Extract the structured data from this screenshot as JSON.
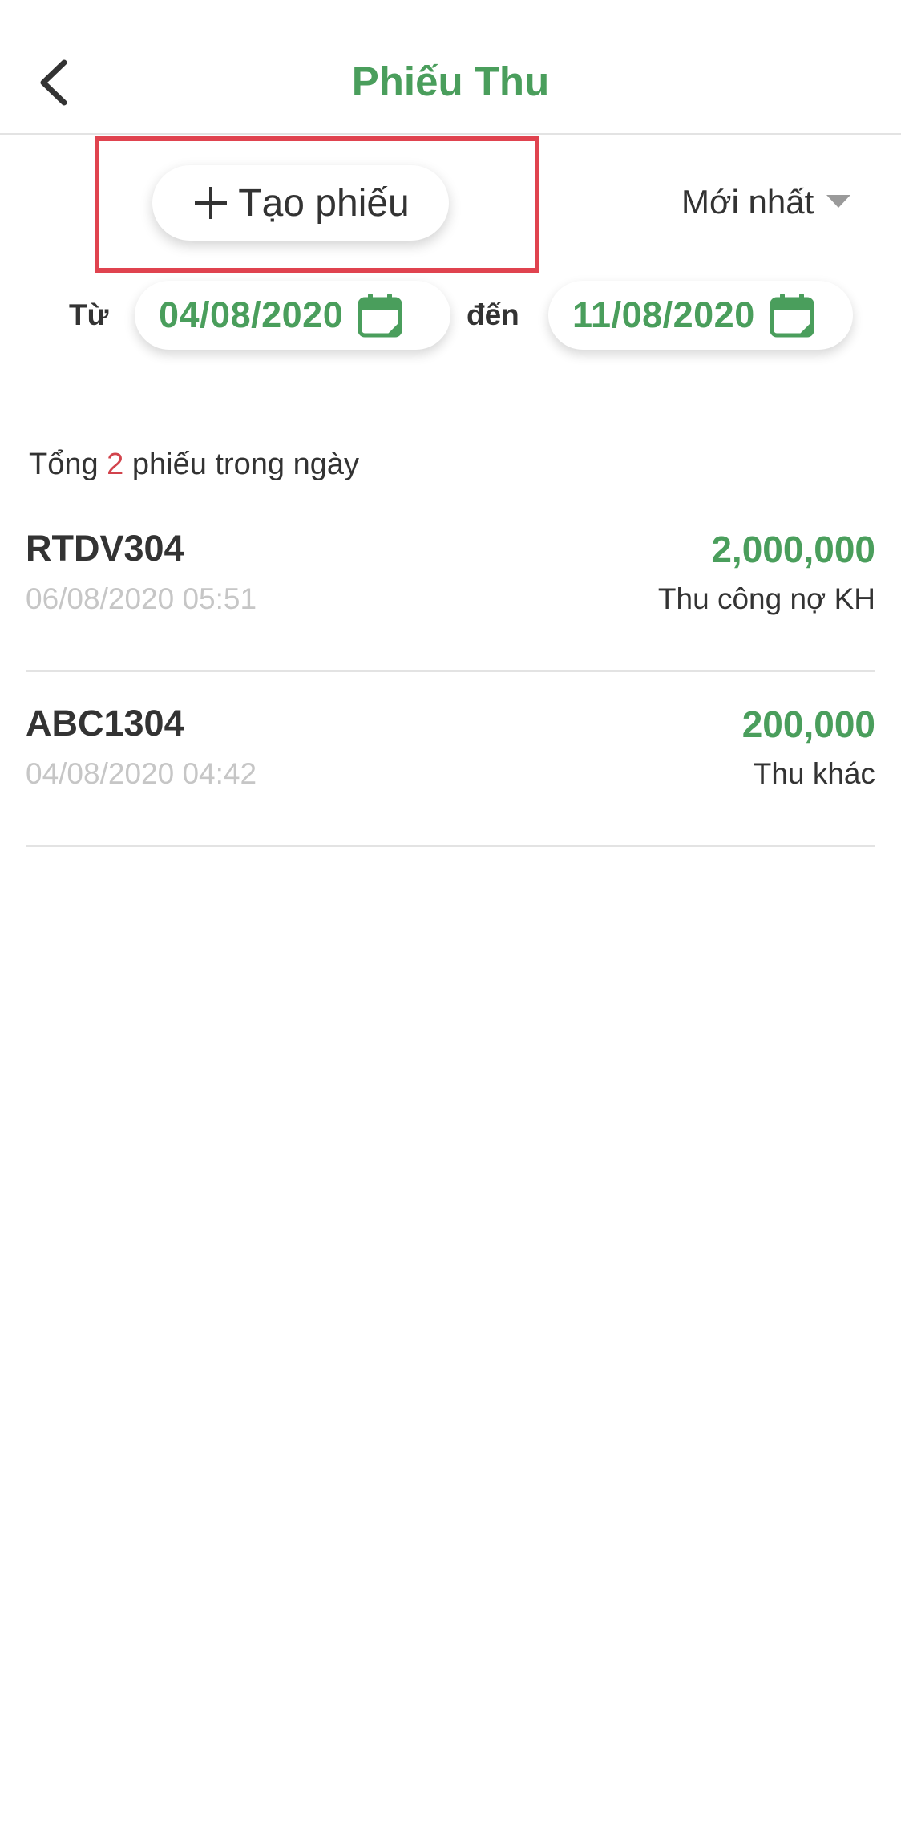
{
  "header": {
    "title": "Phiếu Thu",
    "back_icon": "chevron-left-icon"
  },
  "toolbar": {
    "create_label": "Tạo phiếu",
    "create_icon": "plus-icon",
    "sort_label": "Mới nhất",
    "sort_icon": "caret-down-icon"
  },
  "date_range": {
    "from_label": "Từ",
    "from_value": "04/08/2020",
    "to_label": "đến",
    "to_value": "11/08/2020",
    "calendar_icon": "calendar-icon"
  },
  "summary": {
    "prefix": "Tổng ",
    "count": "2",
    "suffix": " phiếu trong ngày"
  },
  "receipts": [
    {
      "code": "RTDV304",
      "datetime": "06/08/2020 05:51",
      "amount": "2,000,000",
      "type": "Thu công nợ KH"
    },
    {
      "code": "ABC1304",
      "datetime": "04/08/2020 04:42",
      "amount": "200,000",
      "type": "Thu khác"
    }
  ],
  "colors": {
    "accent": "#4a9e5c",
    "highlight": "#e0434f",
    "count": "#d2434c",
    "muted": "#c6c6c6"
  }
}
